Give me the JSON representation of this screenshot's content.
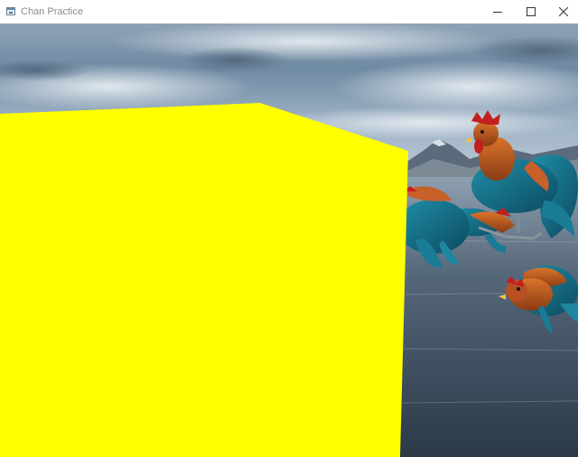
{
  "window": {
    "title": "Chan Practice",
    "icon": "app-window-icon",
    "controls": {
      "minimize_icon": "minimize-icon",
      "maximize_icon": "maximize-icon",
      "close_icon": "close-icon"
    }
  },
  "scene": {
    "cube_color": "#ffff00",
    "sky_color": "#7f97ad",
    "water_color": "#3d4d5c",
    "objects": [
      "yellow-cube",
      "rooster-model",
      "rooster-model",
      "rooster-model"
    ]
  }
}
